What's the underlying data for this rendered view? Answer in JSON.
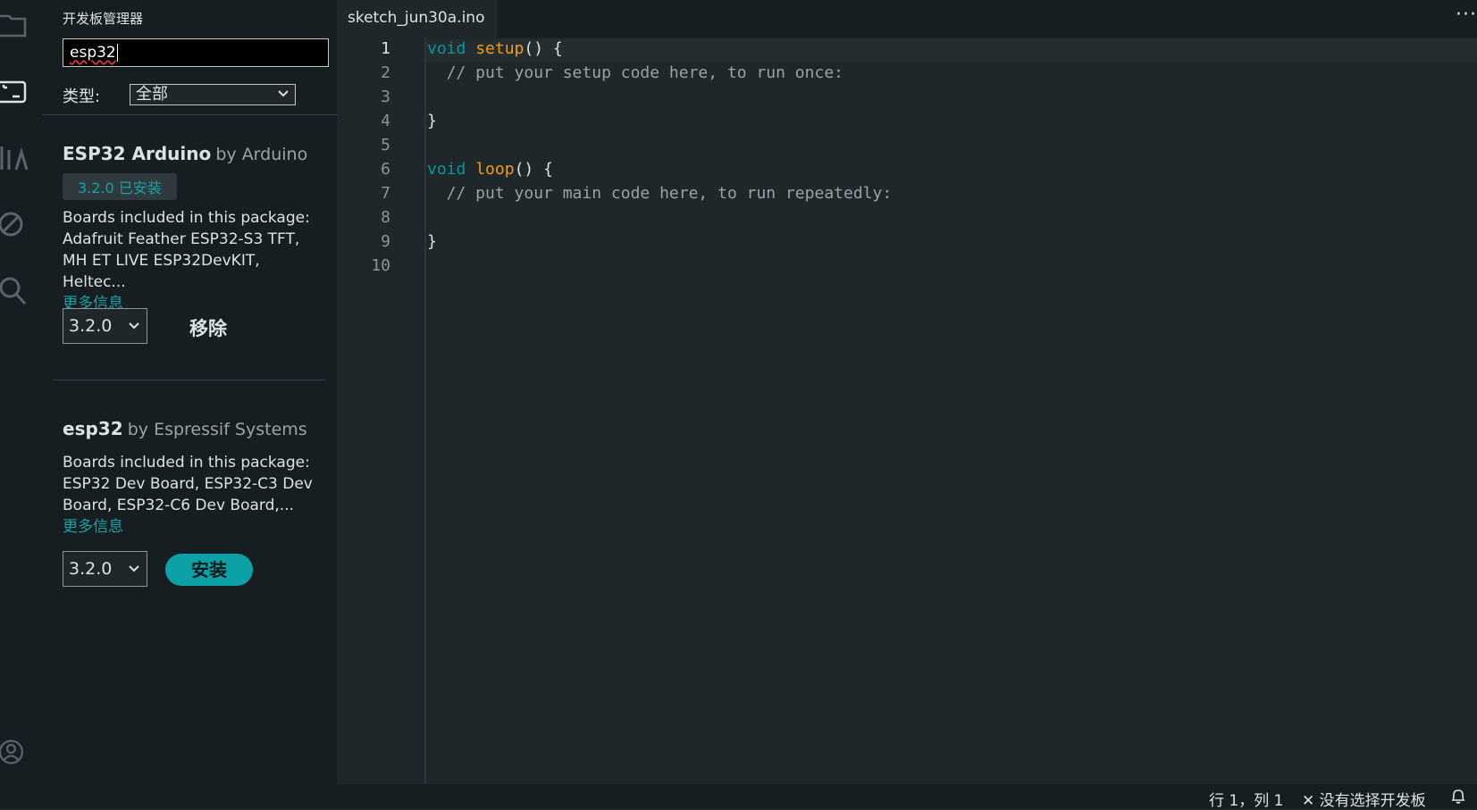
{
  "activity_bar": {
    "icons": [
      "folder-icon",
      "board-manager-icon",
      "library-icon",
      "debug-icon",
      "search-icon",
      "account-icon"
    ]
  },
  "board_manager": {
    "title": "开发板管理器",
    "search": {
      "value": "esp32"
    },
    "type_filter": {
      "label": "类型:",
      "value": "全部"
    },
    "packages": [
      {
        "name": "ESP32 Arduino",
        "by": "by Arduino",
        "installed_badge": "3.2.0 已安装",
        "desc_intro": "Boards included in this package:",
        "desc_line1": "Adafruit Feather ESP32-S3 TFT,",
        "desc_line2": "MH ET LIVE ESP32DevKIT, Heltec...",
        "more_info": "更多信息",
        "version": "3.2.0",
        "action": "移除"
      },
      {
        "name": "esp32",
        "by": "by Espressif Systems",
        "desc_intro": "Boards included in this package:",
        "desc_line1": "ESP32 Dev Board, ESP32-C3 Dev",
        "desc_line2": "Board, ESP32-C6 Dev Board,...",
        "more_info": "更多信息",
        "version": "3.2.0",
        "action": "安装"
      }
    ]
  },
  "editor": {
    "tab_label": "sketch_jun30a.ino",
    "more_label": "···",
    "line_numbers": [
      "1",
      "2",
      "3",
      "4",
      "5",
      "6",
      "7",
      "8",
      "9",
      "10"
    ],
    "lines": [
      {
        "kw": "void",
        "fn": "setup",
        "rest": "() {"
      },
      {
        "comment": "  // put your setup code here, to run once:"
      },
      {
        "plain": ""
      },
      {
        "plain": "}"
      },
      {
        "plain": ""
      },
      {
        "kw": "void",
        "fn": "loop",
        "rest": "() {"
      },
      {
        "comment": "  // put your main code here, to run repeatedly:"
      },
      {
        "plain": ""
      },
      {
        "plain": "}"
      },
      {
        "plain": ""
      }
    ]
  },
  "status_bar": {
    "position": "行 1，列 1",
    "board": "✕ 没有选择开发板"
  },
  "colors": {
    "accent": "#0ca1a6",
    "keyword": "#00979c",
    "function": "#f39c12",
    "comment": "#95a5a6"
  }
}
